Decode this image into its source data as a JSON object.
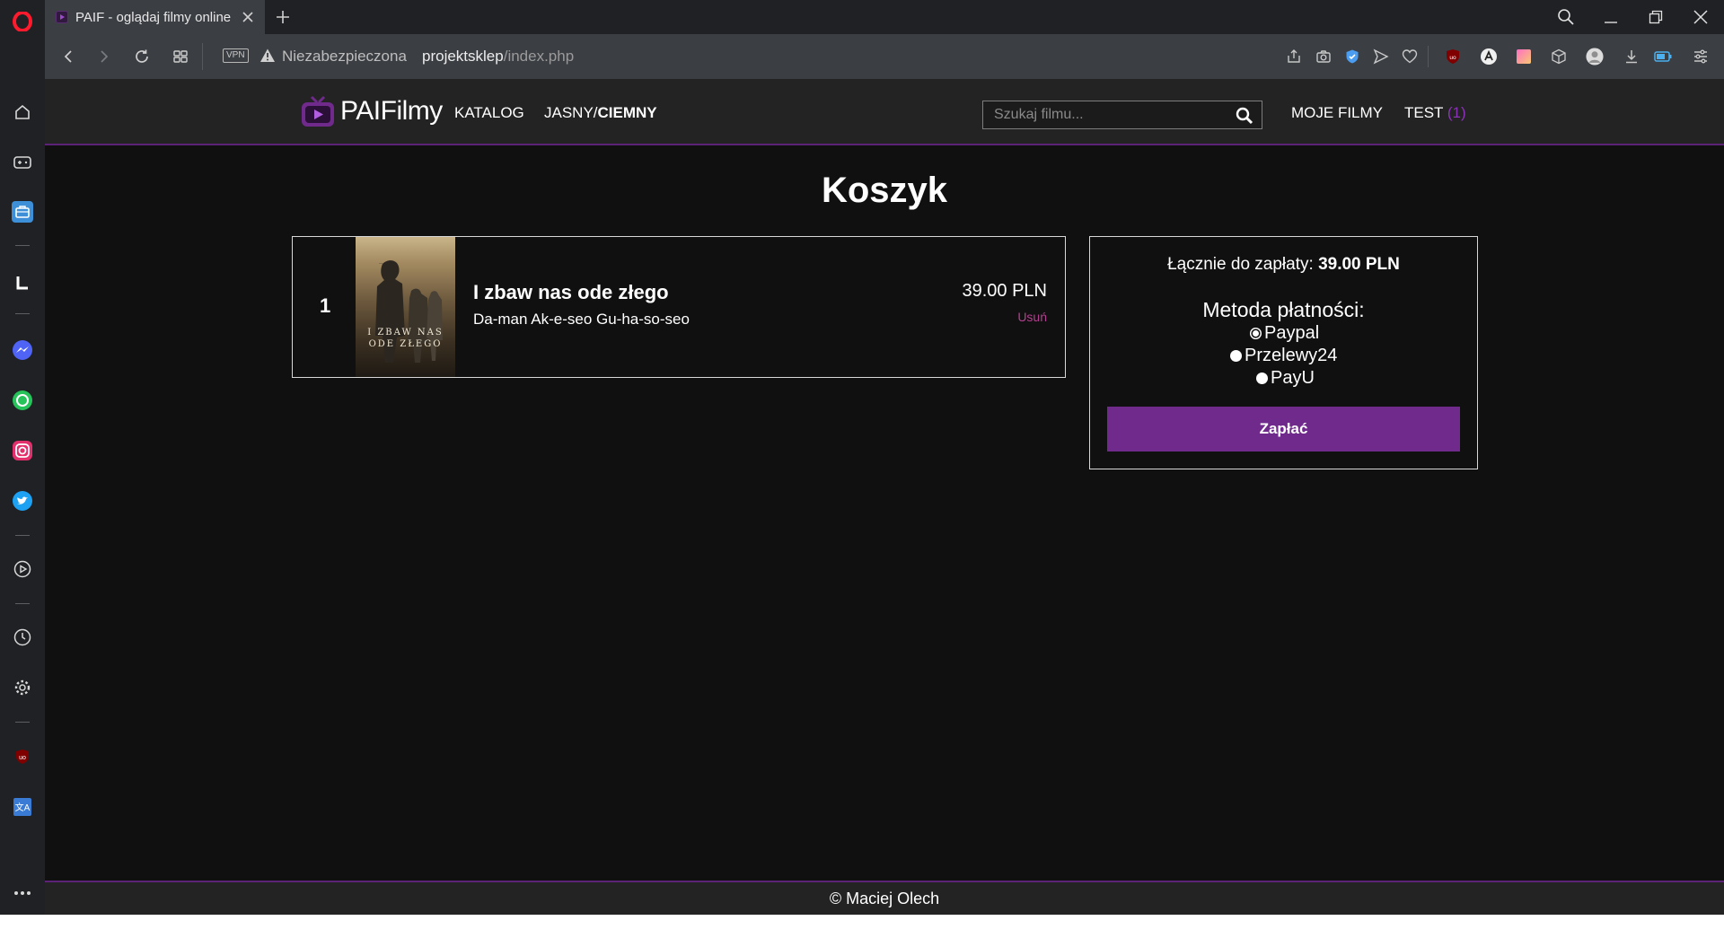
{
  "browser": {
    "tab_title": "PAIF - oglądaj filmy online",
    "vpn_label": "VPN",
    "security_label": "Niezabezpieczona",
    "url_host": "projektsklep",
    "url_path": "/index.php",
    "accent": "#ff1b2d"
  },
  "site": {
    "logo_text": "PAIFilmy",
    "nav": {
      "catalog": "KATALOG",
      "theme_light": "JASNY/",
      "theme_dark": "CIEMNY",
      "my_movies": "MOJE FILMY",
      "user": "TEST",
      "user_count": "(1)"
    },
    "search_placeholder": "Szukaj filmu...",
    "brand_color": "#6f2a8b"
  },
  "cart": {
    "title": "Koszyk",
    "items": [
      {
        "index": "1",
        "title": "I zbaw nas ode złego",
        "original_title": "Da-man Ak-e-seo Gu-ha-so-seo",
        "price": "39.00 PLN",
        "remove_label": "Usuń",
        "poster_text": "I ZBAW NAS ODE ZŁEGO"
      }
    ]
  },
  "summary": {
    "total_label": "Łącznie do zapłaty:",
    "total_value": "39.00 PLN",
    "payment_label": "Metoda płatności:",
    "options": [
      "Paypal",
      "Przelewy24",
      "PayU"
    ],
    "selected": "Paypal",
    "pay_button": "Zapłać"
  },
  "footer": {
    "text": "© Maciej Olech"
  }
}
